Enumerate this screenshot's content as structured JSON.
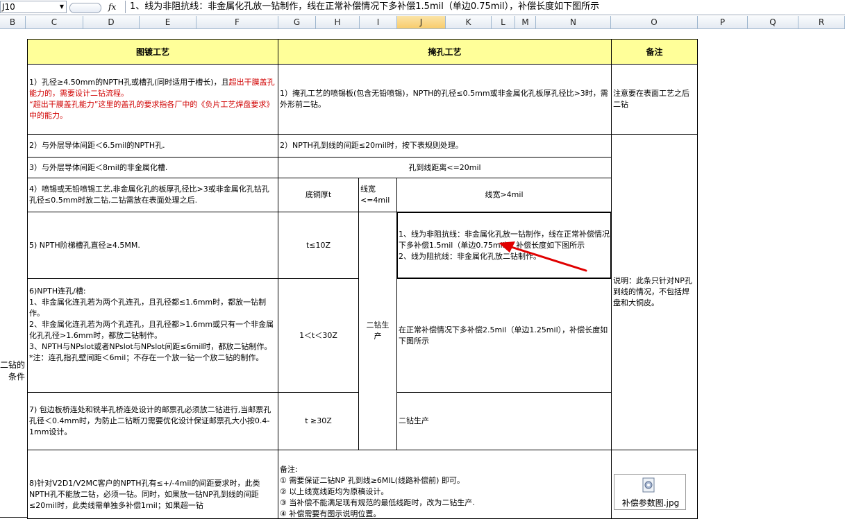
{
  "formula_bar": {
    "cell_ref": "J10",
    "fx_label": "fx",
    "formula": "1、线为非阻抗线：非金属化孔放一钻制作，线在正常补偿情况下多补偿1.5mil（单边0.75mil），补偿长度如下图所示"
  },
  "columns": [
    {
      "label": "B"
    },
    {
      "label": "C"
    },
    {
      "label": "D"
    },
    {
      "label": "E"
    },
    {
      "label": "F"
    },
    {
      "label": "G"
    },
    {
      "label": "H"
    },
    {
      "label": "I"
    },
    {
      "label": "J"
    },
    {
      "label": "K"
    },
    {
      "label": "L"
    },
    {
      "label": "M"
    },
    {
      "label": "N"
    },
    {
      "label": "O"
    },
    {
      "label": "P"
    },
    {
      "label": "Q"
    },
    {
      "label": "R"
    }
  ],
  "headers": {
    "plating": "图镀工艺",
    "tenting": "掩孔工艺",
    "remarks": "备注"
  },
  "left_cut_text": "二钻的\n条件",
  "rows": {
    "r1": {
      "part1": "1）孔径≥4.50mm的NPTH孔或槽孔(同时适用于槽长)，且",
      "part_red1": "超出干膜盖孔能力的，需要设计二钻流程。",
      "part_red2": "“超出干膜盖孔能力”这里的盖孔的要求指各厂中的《负片工艺焊盘要求》中的能力。",
      "tenting": "1）掩孔工艺的喷锡板(包含无铅喷锡)，NPTH的孔径≤0.5mm或非金属化孔板厚孔径比>3时，需外形前二钻。",
      "remark": "注意要在表面工艺之后二钻"
    },
    "r2": {
      "plating": "2）与外层导体间距＜6.5mil的NPTH孔.",
      "tenting": "2）NPTH孔到线的间距≤20mil时，按下表规则处理。"
    },
    "r3": {
      "plating": "3）与外层导体间距＜8mil的非金属化槽.",
      "tenting": "孔到线距离<=20mil"
    },
    "r4": {
      "plating": "4）喷锡或无铅喷锡工艺,非金属化孔的板厚孔径比>3或非金属化孔钻孔孔径≤0.5mm时放二钻,二钻需放在表面处理之后.",
      "base_cu": "底铜厚t",
      "line_narrow": "线宽\n<=4mil",
      "line_wide": "线宽>4mil"
    },
    "r5": {
      "plating": "5) NPTH阶梯槽孔直径≥4.5MM.",
      "t": "t≤10Z",
      "j10": "1、线为非阻抗线：非金属化孔放一钻制作，线在正常补偿情况下多补偿1.5mil（单边0.75mil），补偿长度如下图所示\n2、线为阻抗线：非金属化孔放二钻制作。"
    },
    "r6": {
      "plating": "6)NPTH连孔/槽:\n1、非金属化连孔若为两个孔连孔，且孔径都≤1.6mm时，都放一钻制作。\n2、非金属化连孔若为两个孔连孔，且孔径都>1.6mm或只有一个非金属化孔孔径>1.6mm时，都放二钻制作。\n3、NPTH与NPslot或者NPslot与NPslot间距≤6mil时，都放二钻制作。\n*注：连孔指孔壁间距＜6mil；不存在一个放一钻一个放二钻的制作。",
      "t": "1＜t＜30Z",
      "merged": "二钻生产",
      "comp": "在正常补偿情况下多补偿2.5mil（单边1.25mil），补偿长度如下图所示",
      "remark": "说明：此条只针对NP孔到线的情况，不包括焊盘和大铜皮。"
    },
    "r7": {
      "plating": "7) 包边板桥连处和铣半孔桥连处设计的邮票孔必须放二钻进行,当邮票孔孔径＜0.4mm时，为防止二钻断刀需要优化设计保证邮票孔大小按0.4-1mm设计。",
      "t": "t ≥30Z",
      "right": "二钻生产"
    },
    "r8": {
      "plating": "8)针对V2D1/V2MC客户的NPTH孔有≤+/-4mil的间距要求时，此类NPTH孔不能放二钻，必须一钻。同时，如果放一钻NP孔到线的间距≤20mil时，此类线需单独多补偿1mil；如果超一钻",
      "notes": "备注:\n① 需要保证二钻NP 孔到线≥6MIL(线路补偿前) 即可。\n② 以上线宽线距均为原稿设计。\n③ 当补偿不能满足现有规范的最低线距时，改为二钻生产.\n④ 补偿需要有图示说明位置。"
    }
  },
  "attachment": {
    "filename": "补偿参数图.jpg",
    "icon": "image-file-icon"
  },
  "colors": {
    "header_fill": "#ffff99",
    "red_text": "#d00000",
    "arrow": "#e00000",
    "selected_col": "#f8cc6c"
  }
}
